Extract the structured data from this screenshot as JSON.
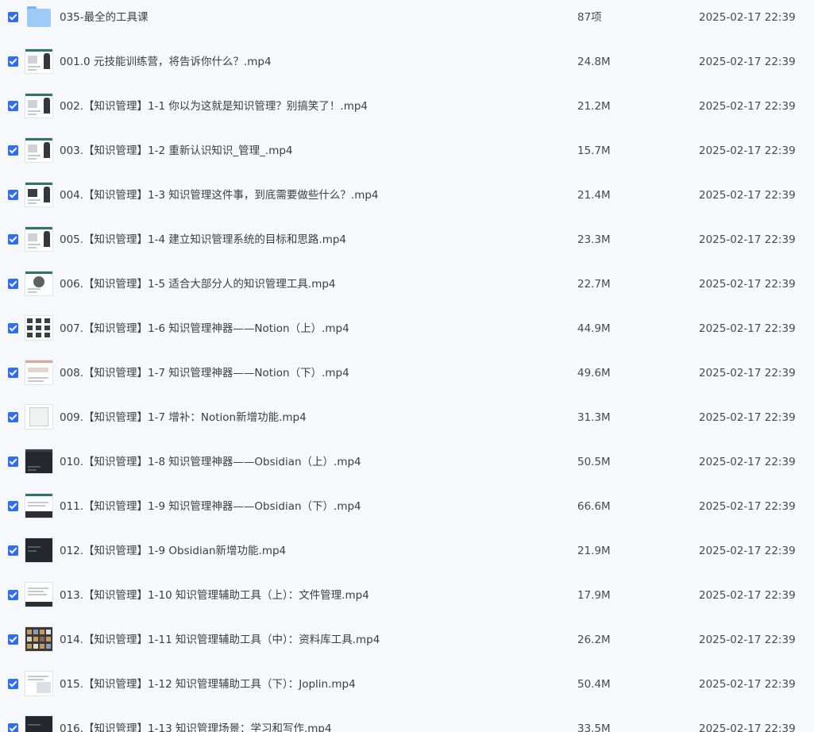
{
  "file_list": {
    "rows": [
      {
        "name": "035-最全的工具课",
        "size": "87项",
        "date": "2025-02-17 22:39",
        "icon": "folder-icon",
        "checked": true
      },
      {
        "name": "001.0 元技能训练营，将告诉你什么？.mp4",
        "size": "24.8M",
        "date": "2025-02-17 22:39",
        "icon": "video-thumbnail",
        "checked": true
      },
      {
        "name": "002.【知识管理】1-1 你以为这就是知识管理？别搞笑了！.mp4",
        "size": "21.2M",
        "date": "2025-02-17 22:39",
        "icon": "video-thumbnail",
        "checked": true
      },
      {
        "name": "003.【知识管理】1-2 重新认识知识_管理_.mp4",
        "size": "15.7M",
        "date": "2025-02-17 22:39",
        "icon": "video-thumbnail",
        "checked": true
      },
      {
        "name": "004.【知识管理】1-3 知识管理这件事，到底需要做些什么？.mp4",
        "size": "21.4M",
        "date": "2025-02-17 22:39",
        "icon": "video-thumbnail",
        "checked": true
      },
      {
        "name": "005.【知识管理】1-4 建立知识管理系统的目标和思路.mp4",
        "size": "23.3M",
        "date": "2025-02-17 22:39",
        "icon": "video-thumbnail",
        "checked": true
      },
      {
        "name": "006.【知识管理】1-5 适合大部分人的知识管理工具.mp4",
        "size": "22.7M",
        "date": "2025-02-17 22:39",
        "icon": "video-thumbnail",
        "checked": true
      },
      {
        "name": "007.【知识管理】1-6 知识管理神器——Notion（上）.mp4",
        "size": "44.9M",
        "date": "2025-02-17 22:39",
        "icon": "video-thumbnail",
        "checked": true
      },
      {
        "name": "008.【知识管理】1-7 知识管理神器——Notion（下）.mp4",
        "size": "49.6M",
        "date": "2025-02-17 22:39",
        "icon": "video-thumbnail",
        "checked": true
      },
      {
        "name": "009.【知识管理】1-7 增补：Notion新增功能.mp4",
        "size": "31.3M",
        "date": "2025-02-17 22:39",
        "icon": "video-thumbnail",
        "checked": true
      },
      {
        "name": "010.【知识管理】1-8 知识管理神器——Obsidian（上）.mp4",
        "size": "50.5M",
        "date": "2025-02-17 22:39",
        "icon": "video-thumbnail",
        "checked": true
      },
      {
        "name": "011.【知识管理】1-9 知识管理神器——Obsidian（下）.mp4",
        "size": "66.6M",
        "date": "2025-02-17 22:39",
        "icon": "video-thumbnail",
        "checked": true
      },
      {
        "name": "012.【知识管理】1-9 Obsidian新增功能.mp4",
        "size": "21.9M",
        "date": "2025-02-17 22:39",
        "icon": "video-thumbnail",
        "checked": true
      },
      {
        "name": "013.【知识管理】1-10 知识管理辅助工具（上）：文件管理.mp4",
        "size": "17.9M",
        "date": "2025-02-17 22:39",
        "icon": "video-thumbnail",
        "checked": true
      },
      {
        "name": "014.【知识管理】1-11 知识管理辅助工具（中）：资料库工具.mp4",
        "size": "26.2M",
        "date": "2025-02-17 22:39",
        "icon": "video-thumbnail",
        "checked": true
      },
      {
        "name": "015.【知识管理】1-12 知识管理辅助工具（下）：Joplin.mp4",
        "size": "50.4M",
        "date": "2025-02-17 22:39",
        "icon": "video-thumbnail",
        "checked": true
      },
      {
        "name": "016.【知识管理】1-13 知识管理场景：学习和写作.mp4",
        "size": "33.5M",
        "date": "2025-02-17 22:39",
        "icon": "video-thumbnail",
        "checked": true
      }
    ]
  },
  "colors": {
    "checkbox": "#2f6df6",
    "folder": "#9ccbf8",
    "background": "#f7f8fc"
  }
}
